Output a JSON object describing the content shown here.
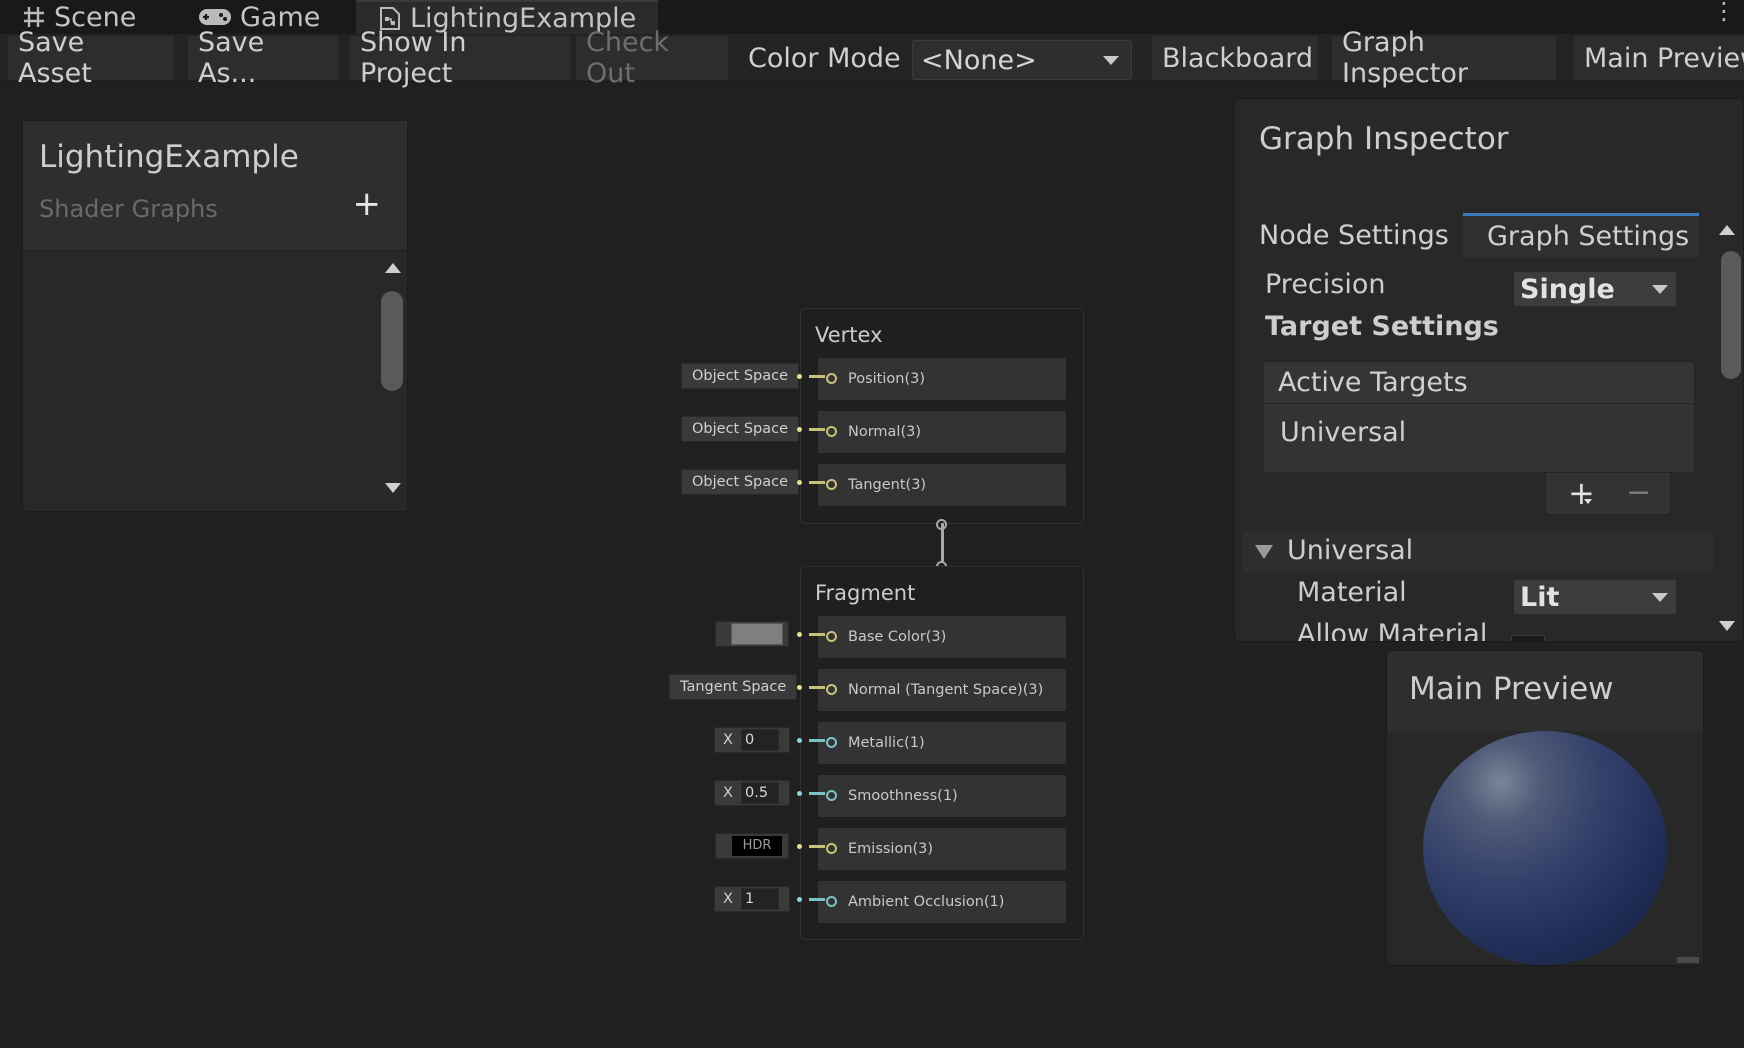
{
  "tabs": [
    {
      "label": "Scene",
      "icon": "hash-grid-icon"
    },
    {
      "label": "Game",
      "icon": "gamepad-icon"
    },
    {
      "label": "LightingExample",
      "icon": "shader-graph-icon",
      "active": true
    }
  ],
  "toolbar": {
    "save_asset": "Save Asset",
    "save_as": "Save As...",
    "show_in_project": "Show In Project",
    "check_out": "Check Out",
    "color_mode_label": "Color Mode",
    "color_mode_value": "<None>",
    "blackboard": "Blackboard",
    "graph_inspector": "Graph Inspector",
    "main_preview": "Main Preview"
  },
  "blackboard": {
    "title": "LightingExample",
    "subtitle": "Shader Graphs",
    "add_symbol": "+"
  },
  "vertex": {
    "title": "Vertex",
    "ports": [
      {
        "label": "Position(3)",
        "input": "Object Space"
      },
      {
        "label": "Normal(3)",
        "input": "Object Space"
      },
      {
        "label": "Tangent(3)",
        "input": "Object Space"
      }
    ]
  },
  "fragment": {
    "title": "Fragment",
    "ports": [
      {
        "label": "Base Color(3)",
        "input_type": "color",
        "color": "#7f7f7f"
      },
      {
        "label": "Normal (Tangent Space)(3)",
        "input": "Tangent Space"
      },
      {
        "label": "Metallic(1)",
        "x_label": "X",
        "value": "0"
      },
      {
        "label": "Smoothness(1)",
        "x_label": "X",
        "value": "0.5"
      },
      {
        "label": "Emission(3)",
        "input": "HDR"
      },
      {
        "label": "Ambient Occlusion(1)",
        "x_label": "X",
        "value": "1"
      }
    ]
  },
  "inspector": {
    "title": "Graph Inspector",
    "tabs": [
      "Node Settings",
      "Graph Settings"
    ],
    "active_tab": "Graph Settings",
    "precision_label": "Precision",
    "precision_value": "Single",
    "target_settings": "Target Settings",
    "active_targets": "Active Targets",
    "target_item": "Universal",
    "add_symbol": "+",
    "remove_symbol": "−",
    "section": "Universal",
    "material_label": "Material",
    "material_value": "Lit",
    "allow_material": "Allow Material"
  },
  "preview": {
    "title": "Main Preview"
  },
  "colors": {
    "vector3_port": "#c9c27a",
    "vector1_port": "#7cc2c9",
    "accent_tab": "#3a79bb"
  }
}
